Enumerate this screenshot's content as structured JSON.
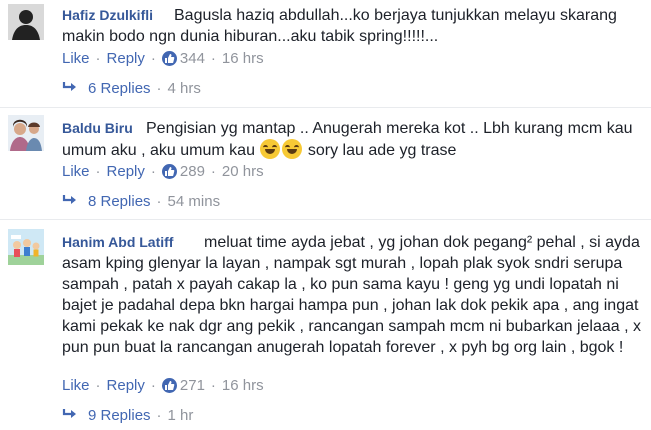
{
  "colors": {
    "link_blue": "#4267b2",
    "name_blue": "#365899",
    "meta_gray": "#90949c",
    "text": "#1d2129",
    "like_badge": "#4267b2"
  },
  "actions_common": {
    "like": "Like",
    "reply": "Reply",
    "separator": "·"
  },
  "comments": [
    {
      "author": "Hafiz Dzulkifli",
      "text": "Bagusla haziq abdullah...ko berjaya tunjukkan melayu skarang makin bodo ngn dunia hiburan...aku tabik spring!!!!!...",
      "likes": "344",
      "time": "16 hrs",
      "replies": "6 Replies",
      "replies_time": "4 hrs",
      "avatar_icon": "silhouette-avatar-icon"
    },
    {
      "author": "Baldu Biru",
      "text_before_emoji": "Pengisian yg mantap .. Anugerah mereka kot .. Lbh kurang mcm kau umum aku , aku umum kau",
      "text_after_emoji": " sory lau ade yg trase",
      "emoji": [
        "laughing-emoji-icon",
        "laughing-emoji-icon"
      ],
      "likes": "289",
      "time": "20 hrs",
      "replies": "8 Replies",
      "replies_time": "54 mins",
      "avatar_icon": "photo-avatar-icon"
    },
    {
      "author": "Hanim Abd Latiff",
      "text": "meluat time ayda jebat , yg johan dok pegang² pehal , si ayda asam kping glenyar la layan , nampak sgt murah , lopah plak syok sndri serupa sampah , patah x payah cakap la , ko pun sama kayu ! geng yg undi lopatah ni bajet je padahal depa bkn hargai hampa pun , johan lak dok pekik apa , ang ingat kami pekak ke nak dgr ang pekik , rancangan sampah mcm ni bubarkan jelaaa , x pun pun buat la rancangan anugerah lopatah forever , x pyh bg org lain , bgok !",
      "likes": "271",
      "time": "16 hrs",
      "replies": "9 Replies",
      "replies_time": "1 hr",
      "avatar_icon": "cartoon-avatar-icon"
    }
  ]
}
